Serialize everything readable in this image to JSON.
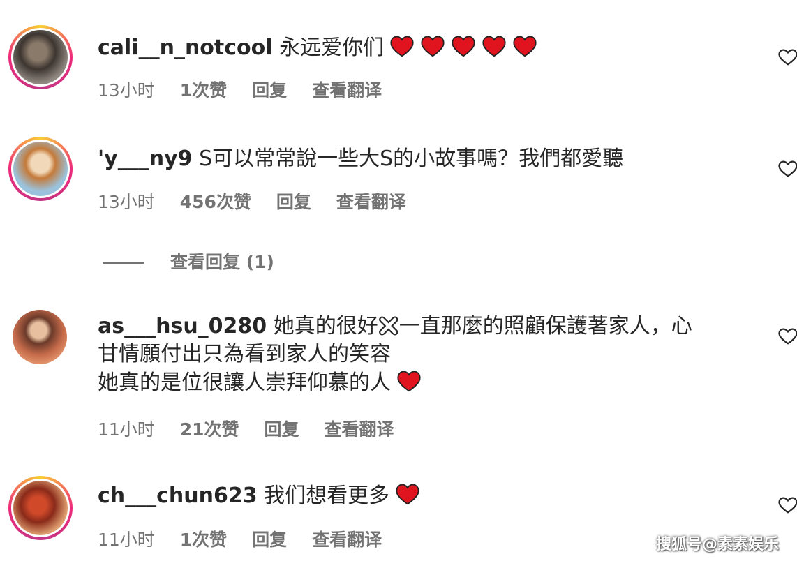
{
  "comments": [
    {
      "username": "cali__n_notcool",
      "text": "永远爱你们",
      "extra_lines": [],
      "hearts": 5,
      "time": "13小时",
      "likes": "1次赞",
      "reply": "回复",
      "translate": "查看翻译"
    },
    {
      "username": "'y___ny9",
      "text": "S可以常常說一些大S的小故事嗎？我們都愛聽",
      "extra_lines": [],
      "hearts": 0,
      "time": "13小时",
      "likes": "456次赞",
      "reply": "回复",
      "translate": "查看翻译"
    },
    {
      "username": "as___hsu_0280",
      "text": "她真的很好🯀一直那麼的照顧保護著家人，心",
      "extra_lines": [
        "甘情願付出只為看到家人的笑容",
        "她真的是位很讓人崇拜仰慕的人"
      ],
      "hearts": 1,
      "time": "11小时",
      "likes": "21次赞",
      "reply": "回复",
      "translate": "查看翻译"
    },
    {
      "username": "ch___chun623",
      "text": "我们想看更多",
      "extra_lines": [],
      "hearts": 1,
      "time": "11小时",
      "likes": "1次赞",
      "reply": "回复",
      "translate": "查看翻译"
    }
  ],
  "view_replies": "查看回复 (1)",
  "watermark": "搜狐号@素素娱乐",
  "icons": {
    "like": "heart-outline-icon",
    "emoji": "red-heart-emoji"
  },
  "colors": {
    "heart": "#e0141e",
    "meta": "#737373",
    "ring_start": "#f9ce34",
    "ring_end": "#c13584"
  }
}
